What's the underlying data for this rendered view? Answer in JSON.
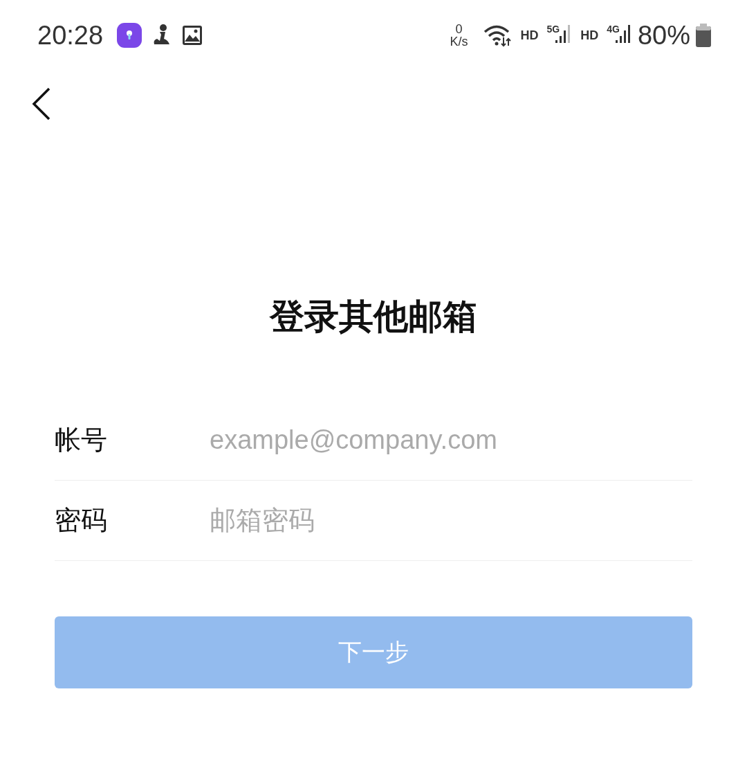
{
  "status_bar": {
    "time": "20:28",
    "speed_value": "0",
    "speed_unit": "K/s",
    "sim_1": {
      "hd": "HD",
      "network": "5G"
    },
    "sim_2": {
      "hd": "HD",
      "network": "4G"
    },
    "battery": "80%"
  },
  "title": "登录其他邮箱",
  "fields": [
    {
      "label": "帐号",
      "placeholder": "example@company.com"
    },
    {
      "label": "密码",
      "placeholder": "邮箱密码"
    }
  ],
  "next_button": {
    "label": "下一步",
    "disabled": true
  }
}
